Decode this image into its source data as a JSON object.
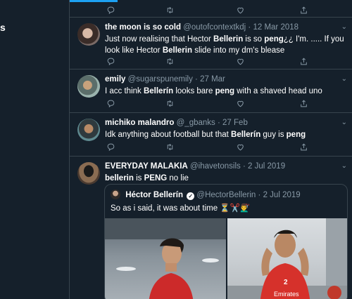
{
  "left_nav": {
    "partial_text": "s"
  },
  "tweets": [
    {
      "name": "the moon is so cold",
      "handle": "@outofcontextkdj",
      "date": "12 Mar 2018",
      "text_parts": [
        "Just now realising that Hector ",
        "Bellerin",
        " is so ",
        "peng",
        "¿¿ I'm. ..... If you look like Hector ",
        "Bellerin",
        " slide into my dm's blease"
      ]
    },
    {
      "name": "emily",
      "handle": "@sugarspunemily",
      "date": "27 Mar",
      "text_parts": [
        "I acc think ",
        "Bellerín",
        " looks bare ",
        "peng",
        " with a shaved head uno"
      ]
    },
    {
      "name": "michiko malandro",
      "handle": "@_gbanks",
      "date": "27 Feb",
      "text_parts": [
        "Idk anything about football but that ",
        "Bellerín",
        " guy is ",
        "peng"
      ]
    },
    {
      "name": "EVERYDAY MALAKIA",
      "handle": "@ihavetonsils",
      "date": "2 Jul 2019",
      "text_parts": [
        "bellerin",
        " is ",
        "PENG",
        " no lie"
      ]
    }
  ],
  "quote": {
    "name": "Héctor Bellerín",
    "handle": "@HectorBellerin",
    "date": "2 Jul 2019",
    "text": "So as i said, it was about time ⏳✂️💇‍♂️"
  },
  "photo_right_text": {
    "number": "2",
    "sponsor": "Emirates"
  },
  "separator": "·",
  "icons": [
    "reply-icon",
    "retweet-icon",
    "like-icon",
    "share-icon",
    "caret-down-icon",
    "verified-icon"
  ],
  "colors": {
    "background": "#15202b",
    "border": "#38444d",
    "muted": "#8899a6",
    "accent": "#1da1f2"
  }
}
